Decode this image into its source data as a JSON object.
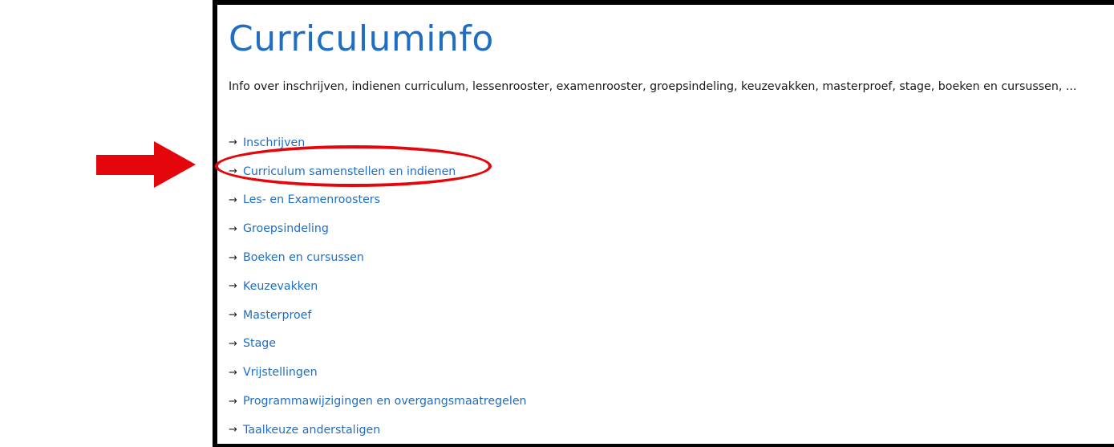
{
  "page": {
    "title": "Curriculuminfo",
    "intro": "Info over inschrijven, indienen curriculum, lessenrooster, examenrooster, groepsindeling, keuzevakken, masterproef, stage, boeken en cursussen, ..."
  },
  "links": [
    {
      "arrow": "→",
      "label": "Inschrijven"
    },
    {
      "arrow": "→",
      "label": "Curriculum samenstellen en indienen"
    },
    {
      "arrow": "→",
      "label": "Les- en Examenroosters"
    },
    {
      "arrow": "→",
      "label": "Groepsindeling"
    },
    {
      "arrow": "→",
      "label": "Boeken en cursussen"
    },
    {
      "arrow": "→",
      "label": "Keuzevakken"
    },
    {
      "arrow": "→",
      "label": "Masterproef"
    },
    {
      "arrow": "→",
      "label": "Stage"
    },
    {
      "arrow": "→",
      "label": "Vrijstellingen"
    },
    {
      "arrow": "→",
      "label": "Programmawijzigingen en overgangsmaatregelen"
    },
    {
      "arrow": "→",
      "label": "Taalkeuze anderstaligen"
    }
  ],
  "annotations": {
    "highlighted_link": "Curriculum samenstellen en indienen",
    "annotation_color": "#e5060b"
  },
  "colors": {
    "link": "#1f6ec4",
    "title": "#1f6ec4",
    "text": "#1a1a1a",
    "border": "#000000"
  }
}
